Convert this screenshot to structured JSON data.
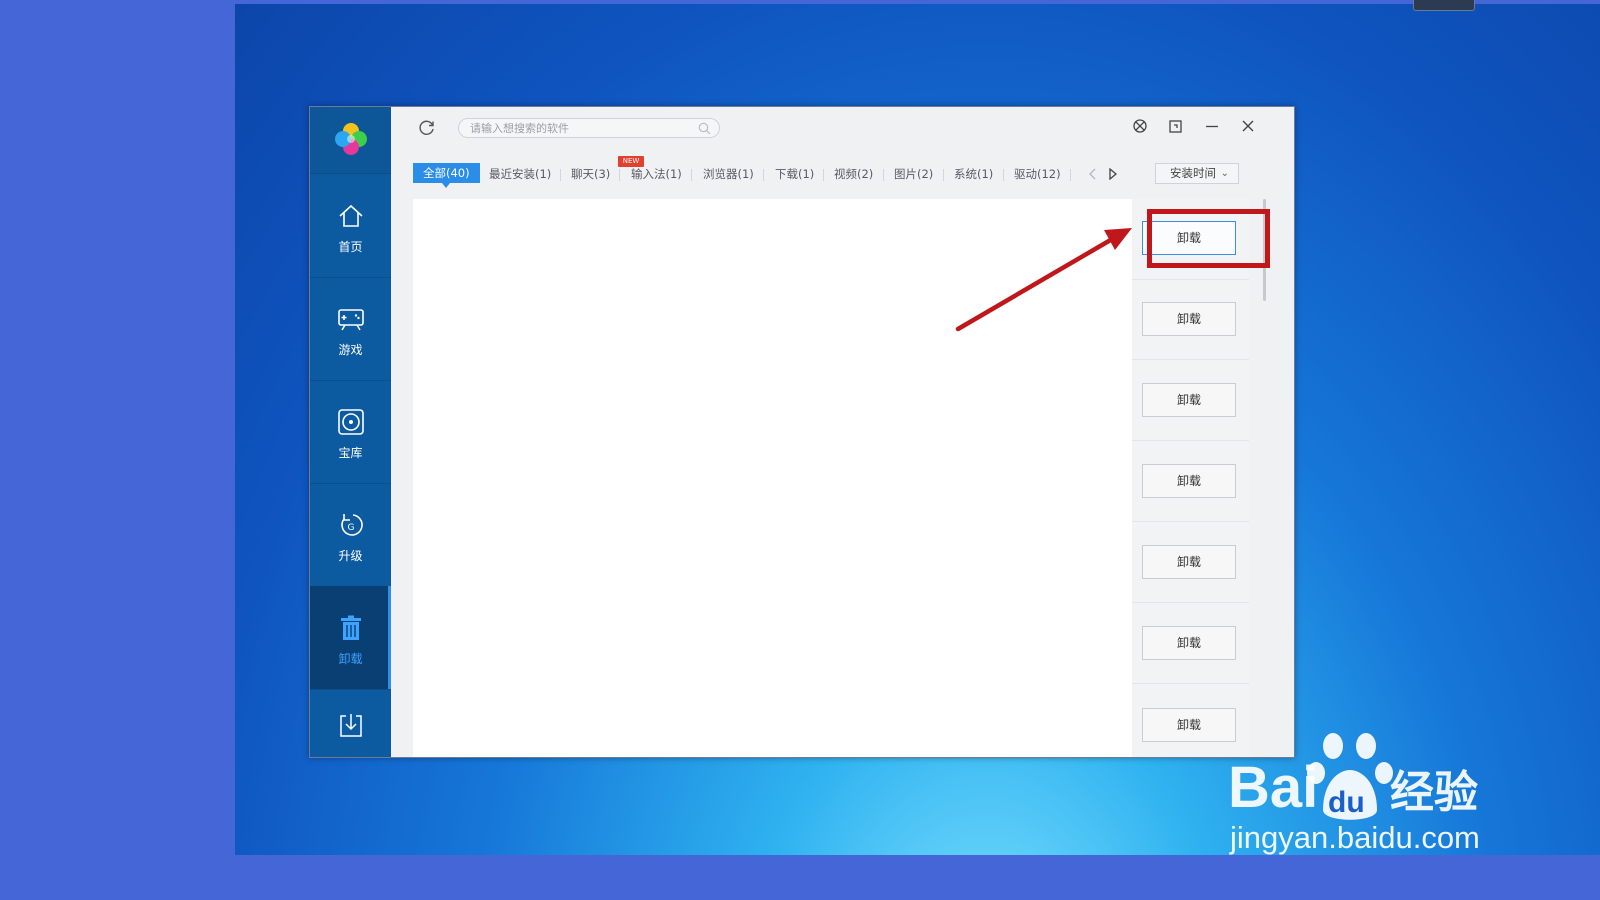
{
  "app": {
    "search_placeholder": "请输入想搜索的软件",
    "sidebar": [
      {
        "label": "首页",
        "icon": "home-icon",
        "active": false
      },
      {
        "label": "游戏",
        "icon": "gamepad-icon",
        "active": false
      },
      {
        "label": "宝库",
        "icon": "disc-icon",
        "active": false
      },
      {
        "label": "升级",
        "icon": "upgrade-icon",
        "active": false
      },
      {
        "label": "卸载",
        "icon": "trash-icon",
        "active": true
      },
      {
        "label": "",
        "icon": "download-icon",
        "active": false
      }
    ],
    "tabs": [
      {
        "label": "全部(40)",
        "active": true
      },
      {
        "label": "最近安装(1)",
        "badge": "NEW"
      },
      {
        "label": "聊天(3)"
      },
      {
        "label": "输入法(1)"
      },
      {
        "label": "浏览器(1)"
      },
      {
        "label": "下载(1)"
      },
      {
        "label": "视频(2)"
      },
      {
        "label": "图片(2)"
      },
      {
        "label": "系统(1)"
      },
      {
        "label": "驱动(12)"
      }
    ],
    "sort_label": "安装时间",
    "uninstall_buttons": [
      "卸载",
      "卸载",
      "卸载",
      "卸载",
      "卸载",
      "卸载",
      "卸载"
    ]
  },
  "watermark": {
    "brand_left": "Bai",
    "brand_mid": "du",
    "brand_right": "经验",
    "url": "jingyan.baidu.com"
  },
  "colors": {
    "accent": "#2a8ee8",
    "sidebar": "#0c5aa0",
    "annotation": "#c0181a"
  }
}
